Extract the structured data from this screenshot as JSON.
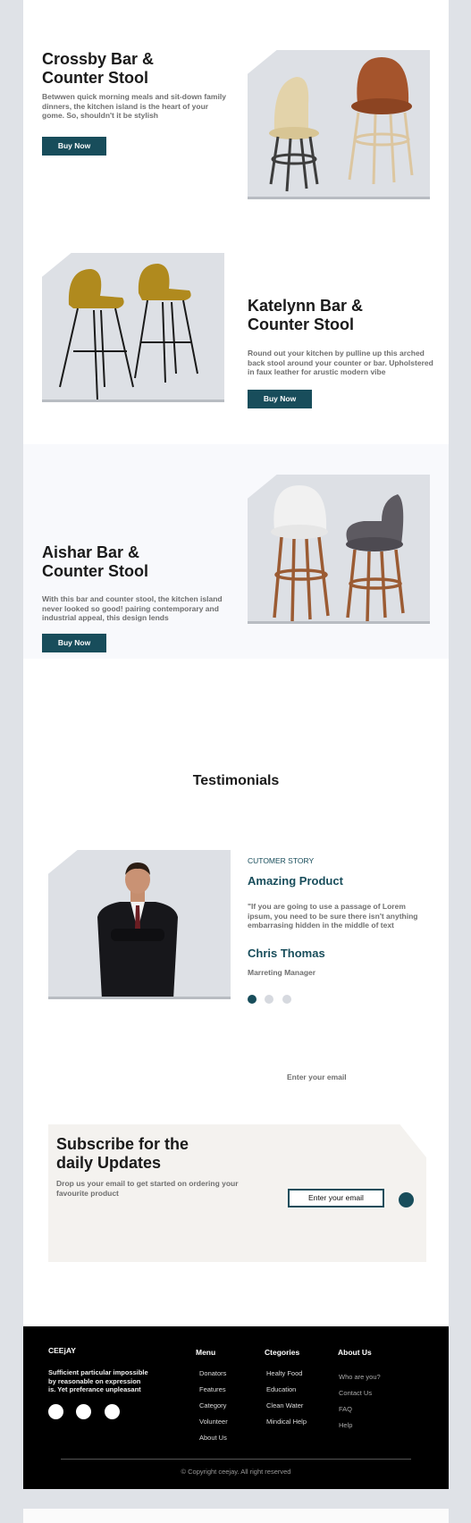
{
  "products": [
    {
      "title_line1": "Crossby Bar &",
      "title_line2": "Counter Stool",
      "desc": "Betwwen quick morning meals and sit-down family dinners, the kitchen island is the heart of your gome. So, shouldn't it be stylish",
      "button": "Buy Now"
    },
    {
      "title_line1": "Katelynn Bar &",
      "title_line2": "Counter Stool",
      "desc": "Round out your kitchen by pulline up this arched back stool around your counter or bar. Upholstered in faux leather for arustic modern vibe",
      "button": "Buy Now"
    },
    {
      "title_line1": "Aishar Bar &",
      "title_line2": "Counter Stool",
      "desc": "With this bar and counter stool, the kitchen island never looked so good! pairing contemporary and industrial appeal, this design lends",
      "button": "Buy Now"
    }
  ],
  "testimonials": {
    "heading": "Testimonials",
    "eyebrow": "CUTOMER STORY",
    "title": "Amazing Product",
    "quote": "\"If you are going to use a passage of Lorem ipsum, you need to be sure there isn't anything embarrasing hidden in the middle of text",
    "name": "Chris Thomas",
    "role": "Marreting Manager",
    "dots": 3,
    "active_dot": 0
  },
  "subscribe": {
    "floating_placeholder": "Enter your email",
    "title_line1": "Subscribe for the",
    "title_line2": "daily Updates",
    "desc": "Drop us your email to get started on ordering your favourite product",
    "input_placeholder": "Enter your email"
  },
  "footer": {
    "brand": "CEEjAY",
    "tagline": "Sufficient particular impossible by reasonable on expression is. Yet preferance unpleasant",
    "social_icons": [
      "social-icon-1",
      "social-icon-2",
      "social-icon-3"
    ],
    "menu": {
      "title": "Menu",
      "items": [
        "Donators",
        "Features",
        "Category",
        "Volunteer",
        "About Us"
      ]
    },
    "categories": {
      "title": "Ctegories",
      "items": [
        "Healty Food",
        "Education",
        "Clean Water",
        "Mindical Help"
      ]
    },
    "about": {
      "title": "About Us",
      "items": [
        "Who are you?",
        "Contact Us",
        "FAQ",
        "Help"
      ]
    },
    "copyright": "Copyright ceejay. All right reserved"
  },
  "colors": {
    "accent": "#184d5b",
    "page_bg": "#dfe2e7",
    "footer_bg": "#000000",
    "subscribe_bg": "#f4f2ef",
    "image_bg": "#dde0e5"
  }
}
